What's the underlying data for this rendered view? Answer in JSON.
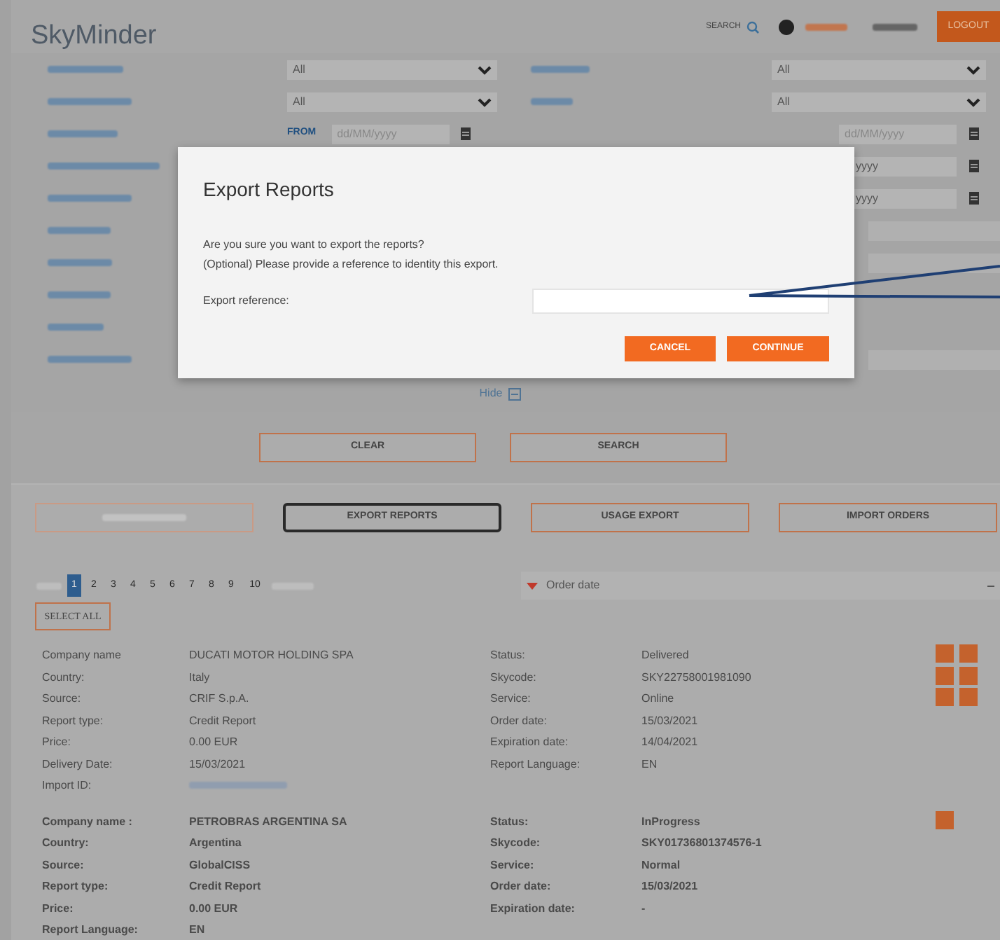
{
  "header": {
    "logo": "SkyMinder",
    "search_label": "SEARCH",
    "logout": "LOGOUT"
  },
  "filters": [
    {
      "kind": "select",
      "left": "All",
      "right": "All"
    },
    {
      "kind": "select",
      "left": "All",
      "right": "All"
    },
    {
      "kind": "date",
      "from": "FROM",
      "left": "dd/MM/yyyy",
      "right": "dd/MM/yyyy"
    },
    {
      "kind": "date_tail",
      "right": "yyyy"
    },
    {
      "kind": "date_tail",
      "right": "yyyy"
    },
    {
      "kind": "field"
    },
    {
      "kind": "field"
    },
    {
      "kind": "none"
    },
    {
      "kind": "none"
    },
    {
      "kind": "field"
    }
  ],
  "hide_label": "Hide",
  "search_buttons": [
    "CLEAR",
    "SEARCH"
  ],
  "actions": [
    {
      "selected": false,
      "disabled": true
    },
    {
      "label": "EXPORT REPORTS",
      "selected": true,
      "disabled": false
    },
    {
      "label": "USAGE EXPORT",
      "selected": false,
      "disabled": false
    },
    {
      "label": "IMPORT ORDERS",
      "selected": false,
      "disabled": false
    }
  ],
  "pages": [
    {
      "label": "1",
      "selected": true
    },
    {
      "label": "2",
      "selected": false
    },
    {
      "label": "3",
      "selected": false
    },
    {
      "label": "4",
      "selected": false
    },
    {
      "label": "5",
      "selected": false
    },
    {
      "label": "6",
      "selected": false
    },
    {
      "label": "7",
      "selected": false
    },
    {
      "label": "8",
      "selected": false
    },
    {
      "label": "9",
      "selected": false
    },
    {
      "label": "10",
      "selected": false
    }
  ],
  "sort": {
    "label": "Order date"
  },
  "select_all": "SELECT ALL",
  "reports": [
    {
      "bold": false,
      "kind": "full",
      "left": [
        [
          "Company name",
          "DUCATI MOTOR HOLDING SPA"
        ],
        [
          "Country:",
          "Italy"
        ],
        [
          "Source:",
          "CRIF S.p.A."
        ],
        [
          "Report type:",
          "Credit Report"
        ],
        [
          "Price:",
          "0.00 EUR"
        ],
        [
          "Delivery Date:",
          "15/03/2021"
        ],
        [
          "Import ID:"
        ]
      ],
      "right": [
        [
          "Status:",
          "Delivered"
        ],
        [
          "Skycode:",
          "SKY22758001981090"
        ],
        [
          "Service:",
          "Online"
        ],
        [
          "Order date:",
          "15/03/2021"
        ],
        [
          "Expiration date:",
          "14/04/2021"
        ],
        [
          "Report Language:",
          "EN"
        ]
      ]
    },
    {
      "bold": true,
      "kind": "single",
      "left": [
        [
          "Company name :",
          "PETROBRAS ARGENTINA SA"
        ],
        [
          "Country:",
          "Argentina"
        ],
        [
          "Source:",
          "GlobalCISS"
        ],
        [
          "Report type:",
          "Credit Report"
        ],
        [
          "Price:",
          "0.00 EUR"
        ],
        [
          "Report Language:",
          "EN"
        ]
      ],
      "right": [
        [
          "Status:",
          "InProgress"
        ],
        [
          "Skycode:",
          "SKY01736801374576-1"
        ],
        [
          "Service:",
          "Normal"
        ],
        [
          "Order date:",
          "15/03/2021"
        ],
        [
          "Expiration date:",
          "-"
        ]
      ]
    }
  ],
  "modal": {
    "title": "Export Reports",
    "lines": [
      "Are you sure you want to export the reports?",
      "(Optional) Please provide a reference to identity this export."
    ],
    "field_label": "Export reference:",
    "buttons": [
      "CANCEL",
      "CONTINUE"
    ]
  }
}
